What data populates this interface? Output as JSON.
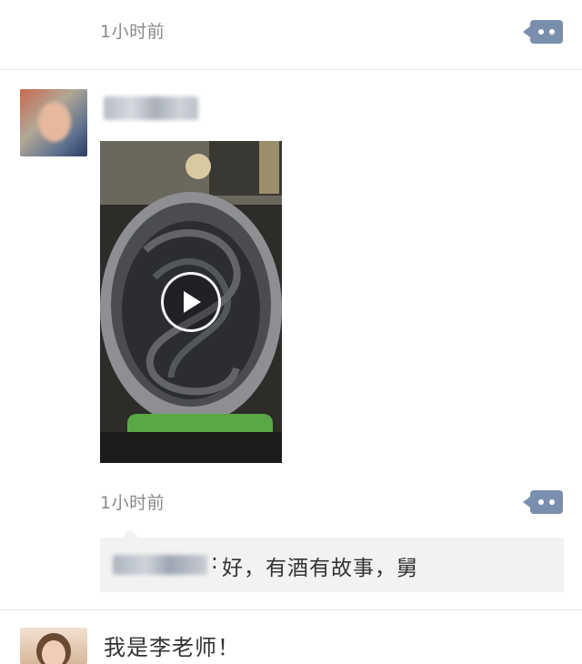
{
  "post_top": {
    "timestamp": "1小时前"
  },
  "post_main": {
    "author_name": "",
    "video": {
      "description": ""
    },
    "timestamp": "1小时前",
    "comments": [
      {
        "commenter": "",
        "separator": ":",
        "text": "好，有酒有故事，舅"
      }
    ]
  },
  "next_post": {
    "text": "我是李老师！"
  },
  "colors": {
    "comment_button": "#7a8fae",
    "timestamp": "#8a8a8a",
    "comment_bg": "#f2f2f2",
    "divider": "#e4e4e4"
  },
  "icons": {
    "comment_button": "more-dots-icon",
    "video_play": "play-icon"
  }
}
